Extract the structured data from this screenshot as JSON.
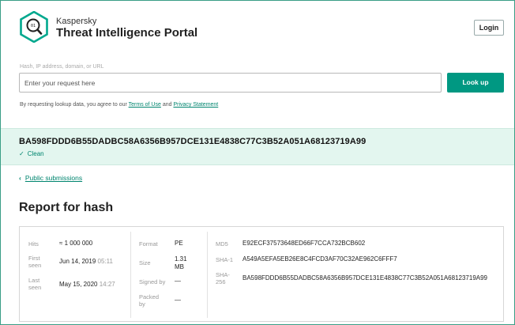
{
  "header": {
    "brand_small": "Kaspersky",
    "brand_big": "Threat Intelligence Portal",
    "login_label": "Login",
    "logo_icon": "kaspersky-ktip-logo-icon"
  },
  "search": {
    "label": "Hash, IP address, domain, or URL",
    "placeholder": "Enter your request here",
    "value": "",
    "button_label": "Look up"
  },
  "terms": {
    "prefix": "By requesting lookup data, you agree to our ",
    "terms_link": "Terms of Use",
    "middle": " and ",
    "privacy_link": "Privacy Statement"
  },
  "banner": {
    "hash": "BA598FDDD6B55DADBC58A6356B957DCE131E4838C77C3B52A051A68123719A99",
    "status": "Clean",
    "status_icon": "checkmark-icon"
  },
  "nav": {
    "back_label": "Public submissions",
    "back_icon": "chevron-left-icon"
  },
  "report": {
    "title": "Report for hash",
    "hits_label": "Hits",
    "hits_value": "≈ 1 000 000",
    "first_seen_label": "First seen",
    "first_seen_date": "Jun 14, 2019",
    "first_seen_time": "05:11",
    "last_seen_label": "Last seen",
    "last_seen_date": "May 15, 2020",
    "last_seen_time": "14:27",
    "format_label": "Format",
    "format_value": "PE",
    "size_label": "Size",
    "size_value": "1.31 MB",
    "signed_by_label": "Signed by",
    "signed_by_value": "—",
    "packed_by_label": "Packed by",
    "packed_by_value": "—",
    "md5_label": "MD5",
    "md5_value": "E92ECF37573648ED66F7CCA732BCB602",
    "sha1_label": "SHA-1",
    "sha1_value": "A549A5EFA5EB26E8C4FCD3AF70C32AE962C6FFF7",
    "sha256_label": "SHA-256",
    "sha256_value": "BA598FDDD6B55DADBC58A6356B957DCE131E4838C77C3B52A051A68123719A99"
  },
  "colors": {
    "accent": "#009882",
    "banner_bg": "#e3f6ef",
    "link": "#00856f"
  }
}
